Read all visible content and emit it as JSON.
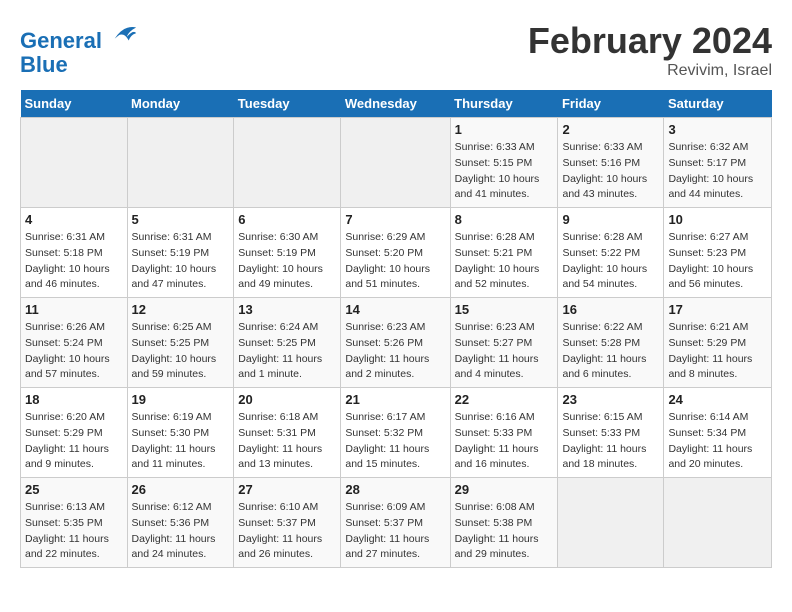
{
  "logo": {
    "line1": "General",
    "line2": "Blue"
  },
  "title": "February 2024",
  "subtitle": "Revivim, Israel",
  "days_of_week": [
    "Sunday",
    "Monday",
    "Tuesday",
    "Wednesday",
    "Thursday",
    "Friday",
    "Saturday"
  ],
  "weeks": [
    [
      {
        "day": "",
        "info": ""
      },
      {
        "day": "",
        "info": ""
      },
      {
        "day": "",
        "info": ""
      },
      {
        "day": "",
        "info": ""
      },
      {
        "day": "1",
        "info": "Sunrise: 6:33 AM\nSunset: 5:15 PM\nDaylight: 10 hours\nand 41 minutes."
      },
      {
        "day": "2",
        "info": "Sunrise: 6:33 AM\nSunset: 5:16 PM\nDaylight: 10 hours\nand 43 minutes."
      },
      {
        "day": "3",
        "info": "Sunrise: 6:32 AM\nSunset: 5:17 PM\nDaylight: 10 hours\nand 44 minutes."
      }
    ],
    [
      {
        "day": "4",
        "info": "Sunrise: 6:31 AM\nSunset: 5:18 PM\nDaylight: 10 hours\nand 46 minutes."
      },
      {
        "day": "5",
        "info": "Sunrise: 6:31 AM\nSunset: 5:19 PM\nDaylight: 10 hours\nand 47 minutes."
      },
      {
        "day": "6",
        "info": "Sunrise: 6:30 AM\nSunset: 5:19 PM\nDaylight: 10 hours\nand 49 minutes."
      },
      {
        "day": "7",
        "info": "Sunrise: 6:29 AM\nSunset: 5:20 PM\nDaylight: 10 hours\nand 51 minutes."
      },
      {
        "day": "8",
        "info": "Sunrise: 6:28 AM\nSunset: 5:21 PM\nDaylight: 10 hours\nand 52 minutes."
      },
      {
        "day": "9",
        "info": "Sunrise: 6:28 AM\nSunset: 5:22 PM\nDaylight: 10 hours\nand 54 minutes."
      },
      {
        "day": "10",
        "info": "Sunrise: 6:27 AM\nSunset: 5:23 PM\nDaylight: 10 hours\nand 56 minutes."
      }
    ],
    [
      {
        "day": "11",
        "info": "Sunrise: 6:26 AM\nSunset: 5:24 PM\nDaylight: 10 hours\nand 57 minutes."
      },
      {
        "day": "12",
        "info": "Sunrise: 6:25 AM\nSunset: 5:25 PM\nDaylight: 10 hours\nand 59 minutes."
      },
      {
        "day": "13",
        "info": "Sunrise: 6:24 AM\nSunset: 5:25 PM\nDaylight: 11 hours\nand 1 minute."
      },
      {
        "day": "14",
        "info": "Sunrise: 6:23 AM\nSunset: 5:26 PM\nDaylight: 11 hours\nand 2 minutes."
      },
      {
        "day": "15",
        "info": "Sunrise: 6:23 AM\nSunset: 5:27 PM\nDaylight: 11 hours\nand 4 minutes."
      },
      {
        "day": "16",
        "info": "Sunrise: 6:22 AM\nSunset: 5:28 PM\nDaylight: 11 hours\nand 6 minutes."
      },
      {
        "day": "17",
        "info": "Sunrise: 6:21 AM\nSunset: 5:29 PM\nDaylight: 11 hours\nand 8 minutes."
      }
    ],
    [
      {
        "day": "18",
        "info": "Sunrise: 6:20 AM\nSunset: 5:29 PM\nDaylight: 11 hours\nand 9 minutes."
      },
      {
        "day": "19",
        "info": "Sunrise: 6:19 AM\nSunset: 5:30 PM\nDaylight: 11 hours\nand 11 minutes."
      },
      {
        "day": "20",
        "info": "Sunrise: 6:18 AM\nSunset: 5:31 PM\nDaylight: 11 hours\nand 13 minutes."
      },
      {
        "day": "21",
        "info": "Sunrise: 6:17 AM\nSunset: 5:32 PM\nDaylight: 11 hours\nand 15 minutes."
      },
      {
        "day": "22",
        "info": "Sunrise: 6:16 AM\nSunset: 5:33 PM\nDaylight: 11 hours\nand 16 minutes."
      },
      {
        "day": "23",
        "info": "Sunrise: 6:15 AM\nSunset: 5:33 PM\nDaylight: 11 hours\nand 18 minutes."
      },
      {
        "day": "24",
        "info": "Sunrise: 6:14 AM\nSunset: 5:34 PM\nDaylight: 11 hours\nand 20 minutes."
      }
    ],
    [
      {
        "day": "25",
        "info": "Sunrise: 6:13 AM\nSunset: 5:35 PM\nDaylight: 11 hours\nand 22 minutes."
      },
      {
        "day": "26",
        "info": "Sunrise: 6:12 AM\nSunset: 5:36 PM\nDaylight: 11 hours\nand 24 minutes."
      },
      {
        "day": "27",
        "info": "Sunrise: 6:10 AM\nSunset: 5:37 PM\nDaylight: 11 hours\nand 26 minutes."
      },
      {
        "day": "28",
        "info": "Sunrise: 6:09 AM\nSunset: 5:37 PM\nDaylight: 11 hours\nand 27 minutes."
      },
      {
        "day": "29",
        "info": "Sunrise: 6:08 AM\nSunset: 5:38 PM\nDaylight: 11 hours\nand 29 minutes."
      },
      {
        "day": "",
        "info": ""
      },
      {
        "day": "",
        "info": ""
      }
    ]
  ]
}
